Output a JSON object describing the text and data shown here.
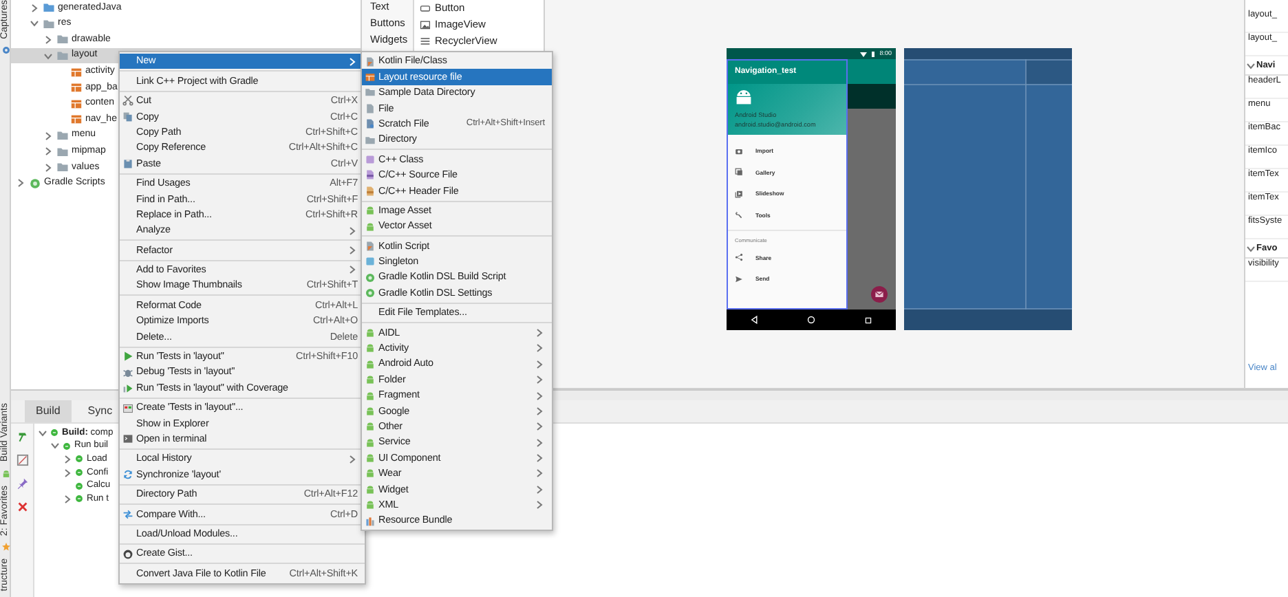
{
  "left_strip": {
    "top": [
      {
        "label": "Captures",
        "kind": "gear"
      }
    ],
    "bottom": [
      {
        "label": "Build Variants",
        "kind": "android"
      },
      {
        "label": "2: Favorites",
        "kind": "star"
      },
      {
        "label": "tructure"
      }
    ]
  },
  "project_tree": [
    {
      "children": [
        {
          "label": "generatedJava",
          "kind": "source-folder",
          "expanded": false,
          "selected": false
        },
        {
          "label": "res",
          "kind": "folder",
          "expanded": true,
          "selected": false,
          "children": [
            {
              "label": "drawable",
              "kind": "folder",
              "expanded": false,
              "selected": false
            },
            {
              "label": "layout",
              "kind": "folder",
              "expanded": true,
              "selected": true,
              "children": [
                {
                  "label": "activity",
                  "kind": "layout",
                  "selected": false
                },
                {
                  "label": "app_ba",
                  "kind": "layout",
                  "selected": false
                },
                {
                  "label": "conten",
                  "kind": "layout",
                  "selected": false
                },
                {
                  "label": "nav_he",
                  "kind": "layout",
                  "selected": false
                }
              ]
            },
            {
              "label": "menu",
              "kind": "folder",
              "expanded": false,
              "selected": false
            },
            {
              "label": "mipmap",
              "kind": "folder",
              "expanded": false,
              "selected": false
            },
            {
              "label": "values",
              "kind": "folder",
              "expanded": false,
              "selected": false
            }
          ]
        }
      ]
    },
    {
      "label": "Gradle Scripts",
      "kind": "gradle",
      "expanded": false,
      "selected": false
    }
  ],
  "palette": {
    "categories": [
      "Text",
      "Buttons",
      "Widgets"
    ],
    "widgets": [
      {
        "label": "Button",
        "kind": "button"
      },
      {
        "label": "ImageView",
        "kind": "image"
      },
      {
        "label": "RecyclerView",
        "kind": "list"
      }
    ]
  },
  "preview": {
    "status_time": "8:00",
    "app_title": "Navigation_test",
    "header_name": "Android Studio",
    "header_email": "android.studio@android.com",
    "items": [
      {
        "label": "Import",
        "kind": "camera"
      },
      {
        "label": "Gallery",
        "kind": "gallery"
      },
      {
        "label": "Slideshow",
        "kind": "slideshow"
      },
      {
        "label": "Tools",
        "kind": "wrench"
      }
    ],
    "section_title": "Communicate",
    "section_items": [
      {
        "label": "Share",
        "kind": "share"
      },
      {
        "label": "Send",
        "kind": "send"
      }
    ]
  },
  "attributes": [
    {
      "kind": "row",
      "label": "layout_"
    },
    {
      "kind": "row",
      "label": "layout_"
    },
    {
      "kind": "section",
      "label": "Navi",
      "expanded": true
    },
    {
      "kind": "row",
      "label": "headerL"
    },
    {
      "kind": "row",
      "label": "menu"
    },
    {
      "kind": "row",
      "label": "itemBac"
    },
    {
      "kind": "row",
      "label": "itemIco"
    },
    {
      "kind": "row",
      "label": "itemTex"
    },
    {
      "kind": "row",
      "label": "itemTex"
    },
    {
      "kind": "row",
      "label": "fitsSyste"
    },
    {
      "kind": "section",
      "label": "Favo",
      "expanded": true
    },
    {
      "kind": "row",
      "label": "visibility"
    }
  ],
  "view_all_link": "View al",
  "bottom_panel": {
    "tabs": [
      {
        "label": "Build",
        "selected": true
      },
      {
        "label": "Sync",
        "selected": false
      }
    ],
    "build_tree": [
      {
        "label": "**Build:** comp",
        "expanded": true,
        "children": [
          {
            "label": "Run buil",
            "expanded": true,
            "children": [
              {
                "label": "Load",
                "expanded": false
              },
              {
                "label": "Confi",
                "expanded": false
              },
              {
                "label": "Calcu"
              },
              {
                "label": "Run t",
                "expanded": false
              }
            ]
          }
        ]
      }
    ]
  },
  "context_menu": {
    "groups": [
      [
        {
          "label": "New",
          "selected": true,
          "submenu": true
        }
      ],
      [
        {
          "label": "Link C++ Project with Gradle",
          "selected": false
        }
      ],
      [
        {
          "label": "Cut",
          "kind": "scissors",
          "shortcut": "Ctrl+X",
          "selected": false
        },
        {
          "label": "Copy",
          "kind": "copy",
          "shortcut": "Ctrl+C",
          "selected": false
        },
        {
          "label": "Copy Path",
          "shortcut": "Ctrl+Shift+C",
          "selected": false
        },
        {
          "label": "Copy Reference",
          "shortcut": "Ctrl+Alt+Shift+C",
          "selected": false
        },
        {
          "label": "Paste",
          "kind": "paste",
          "shortcut": "Ctrl+V",
          "selected": false
        }
      ],
      [
        {
          "label": "Find Usages",
          "shortcut": "Alt+F7",
          "selected": false
        },
        {
          "label": "Find in Path...",
          "shortcut": "Ctrl+Shift+F",
          "selected": false
        },
        {
          "label": "Replace in Path...",
          "shortcut": "Ctrl+Shift+R",
          "selected": false
        },
        {
          "label": "Analyze",
          "submenu": true,
          "selected": false
        }
      ],
      [
        {
          "label": "Refactor",
          "submenu": true,
          "selected": false
        }
      ],
      [
        {
          "label": "Add to Favorites",
          "submenu": true,
          "selected": false
        },
        {
          "label": "Show Image Thumbnails",
          "shortcut": "Ctrl+Shift+T",
          "selected": false
        }
      ],
      [
        {
          "label": "Reformat Code",
          "shortcut": "Ctrl+Alt+L",
          "selected": false
        },
        {
          "label": "Optimize Imports",
          "shortcut": "Ctrl+Alt+O",
          "selected": false
        },
        {
          "label": "Delete...",
          "shortcut": "Delete",
          "selected": false
        }
      ],
      [
        {
          "label": "Run 'Tests in 'layout''",
          "kind": "play",
          "shortcut": "Ctrl+Shift+F10",
          "selected": false
        },
        {
          "label": "Debug 'Tests in 'layout''",
          "kind": "bug",
          "selected": false
        },
        {
          "label": "Run 'Tests in 'layout'' with Coverage",
          "kind": "coverage",
          "selected": false
        }
      ],
      [
        {
          "label": "Create 'Tests in 'layout''...",
          "kind": "test",
          "selected": false
        },
        {
          "label": "Show in Explorer",
          "selected": false
        },
        {
          "label": "Open in terminal",
          "kind": "terminal",
          "selected": false
        }
      ],
      [
        {
          "label": "Local History",
          "submenu": true,
          "selected": false
        },
        {
          "label": "Synchronize 'layout'",
          "kind": "sync",
          "selected": false
        }
      ],
      [
        {
          "label": "Directory Path",
          "shortcut": "Ctrl+Alt+F12",
          "selected": false
        }
      ],
      [
        {
          "label": "Compare With...",
          "kind": "compare",
          "shortcut": "Ctrl+D",
          "selected": false
        }
      ],
      [
        {
          "label": "Load/Unload Modules...",
          "selected": false
        }
      ],
      [
        {
          "label": "Create Gist...",
          "kind": "gist",
          "selected": false
        }
      ],
      [
        {
          "label": "Convert Java File to Kotlin File",
          "shortcut": "Ctrl+Alt+Shift+K",
          "selected": false
        }
      ]
    ]
  },
  "new_submenu": {
    "groups": [
      [
        {
          "label": "Kotlin File/Class",
          "kind": "kotlin",
          "selected": false
        },
        {
          "label": "Layout resource file",
          "kind": "layout",
          "selected": true
        },
        {
          "label": "Sample Data Directory",
          "kind": "folder",
          "selected": false
        },
        {
          "label": "File",
          "kind": "file",
          "selected": false
        },
        {
          "label": "Scratch File",
          "kind": "scratch",
          "shortcut": "Ctrl+Alt+Shift+Insert",
          "selected": false
        },
        {
          "label": "Directory",
          "kind": "folder",
          "selected": false
        }
      ],
      [
        {
          "label": "C++ Class",
          "kind": "cpp",
          "selected": false
        },
        {
          "label": "C/C++ Source File",
          "kind": "csrc",
          "selected": false
        },
        {
          "label": "C/C++ Header File",
          "kind": "chead",
          "selected": false
        }
      ],
      [
        {
          "label": "Image Asset",
          "kind": "android",
          "selected": false
        },
        {
          "label": "Vector Asset",
          "kind": "android",
          "selected": false
        }
      ],
      [
        {
          "label": "Kotlin Script",
          "kind": "kotlin",
          "selected": false
        },
        {
          "label": "Singleton",
          "kind": "singleton",
          "selected": false
        },
        {
          "label": "Gradle Kotlin DSL Build Script",
          "kind": "gradle",
          "selected": false
        },
        {
          "label": "Gradle Kotlin DSL Settings",
          "kind": "gradle",
          "selected": false
        }
      ],
      [
        {
          "label": "Edit File Templates...",
          "selected": false
        }
      ],
      [
        {
          "label": "AIDL",
          "kind": "android",
          "submenu": true,
          "selected": false
        },
        {
          "label": "Activity",
          "kind": "android",
          "submenu": true,
          "selected": false
        },
        {
          "label": "Android Auto",
          "kind": "android",
          "submenu": true,
          "selected": false
        },
        {
          "label": "Folder",
          "kind": "android",
          "submenu": true,
          "selected": false
        },
        {
          "label": "Fragment",
          "kind": "android",
          "submenu": true,
          "selected": false
        },
        {
          "label": "Google",
          "kind": "android",
          "submenu": true,
          "selected": false
        },
        {
          "label": "Other",
          "kind": "android",
          "submenu": true,
          "selected": false
        },
        {
          "label": "Service",
          "kind": "android",
          "submenu": true,
          "selected": false
        },
        {
          "label": "UI Component",
          "kind": "android",
          "submenu": true,
          "selected": false
        },
        {
          "label": "Wear",
          "kind": "android",
          "submenu": true,
          "selected": false
        },
        {
          "label": "Widget",
          "kind": "android",
          "submenu": true,
          "selected": false
        },
        {
          "label": "XML",
          "kind": "android",
          "submenu": true,
          "selected": false
        },
        {
          "label": "Resource Bundle",
          "kind": "bundle",
          "selected": false
        }
      ]
    ]
  }
}
